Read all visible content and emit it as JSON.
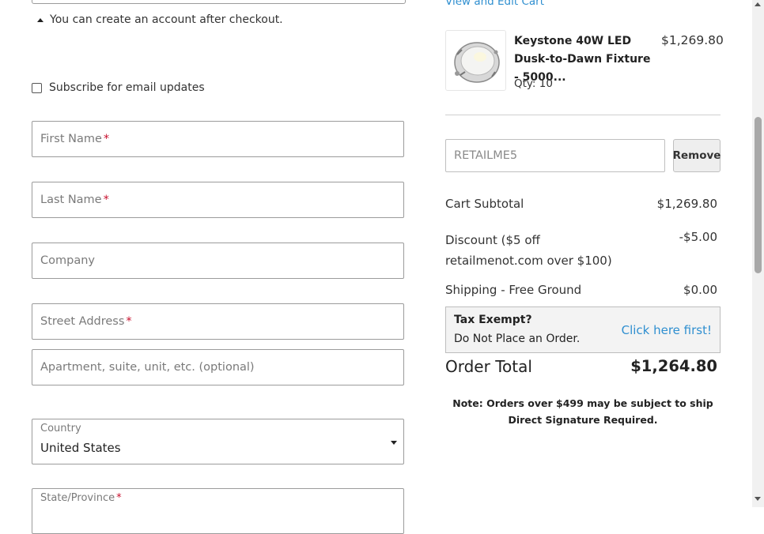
{
  "checkout": {
    "account_note": "You can create an account after checkout.",
    "subscribe_label": "Subscribe for email updates",
    "subscribe_checked": false,
    "first_name_placeholder": "First Name",
    "last_name_placeholder": "Last Name",
    "company_placeholder": "Company",
    "street_placeholder": "Street Address",
    "apartment_placeholder": "Apartment, suite, unit, etc. (optional)",
    "country_label": "Country",
    "country_value": "United States",
    "state_label": "State/Province",
    "required_marker": "*"
  },
  "cart": {
    "view_edit_link": "View and Edit Cart",
    "item": {
      "name": "Keystone 40W LED Dusk-to-Dawn Fixture - 5000...",
      "price": "$1,269.80",
      "qty": "Qty: 10"
    },
    "coupon_code": "RETAILME5",
    "remove_label": "Remove",
    "subtotal_label": "Cart Subtotal",
    "subtotal_value": "$1,269.80",
    "discount_label": "Discount ($5 off retailmenot.com over $100)",
    "discount_value": "-$5.00",
    "shipping_label": "Shipping - Free Ground",
    "shipping_value": "$0.00",
    "tax_title": "Tax Exempt?",
    "tax_sub": "Do Not Place an Order.",
    "tax_link": "Click here first!",
    "total_label": "Order Total",
    "total_value": "$1,264.80",
    "note": "Note: Orders over $499 may be subject to ship Direct Signature Required."
  },
  "colors": {
    "link": "#2f8fd0",
    "required": "#c8102e",
    "tax_box_bg": "#f3f3f3"
  }
}
